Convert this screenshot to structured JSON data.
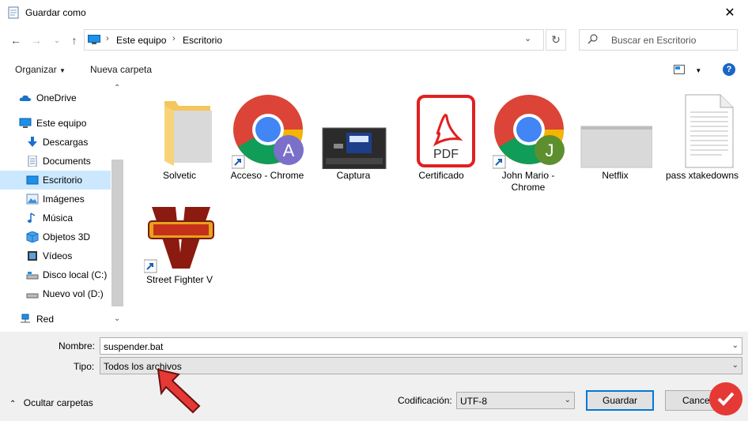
{
  "window": {
    "title": "Guardar como"
  },
  "address": {
    "crumbs": [
      "Este equipo",
      "Escritorio"
    ]
  },
  "search": {
    "placeholder": "Buscar en Escritorio"
  },
  "toolbar": {
    "organize": "Organizar",
    "new_folder": "Nueva carpeta"
  },
  "sidebar": {
    "items": [
      {
        "label": "OneDrive",
        "icon": "cloud-icon"
      },
      {
        "label": "Este equipo",
        "icon": "computer-icon"
      },
      {
        "label": "Descargas",
        "icon": "download-icon"
      },
      {
        "label": "Documents",
        "icon": "document-icon"
      },
      {
        "label": "Escritorio",
        "icon": "desktop-icon",
        "selected": true
      },
      {
        "label": "Imágenes",
        "icon": "image-icon"
      },
      {
        "label": "Música",
        "icon": "music-icon"
      },
      {
        "label": "Objetos 3D",
        "icon": "cube-icon"
      },
      {
        "label": "Vídeos",
        "icon": "video-icon"
      },
      {
        "label": "Disco local (C:)",
        "icon": "drive-icon"
      },
      {
        "label": "Nuevo vol (D:)",
        "icon": "drive-icon"
      },
      {
        "label": "Red",
        "icon": "network-icon"
      }
    ]
  },
  "files": [
    {
      "name": "Solvetic",
      "icon": "folder-icon"
    },
    {
      "name": "Acceso - Chrome",
      "icon": "chrome-icon",
      "badge": "A"
    },
    {
      "name": "Captura",
      "icon": "image-thumbnail"
    },
    {
      "name": "Certificado",
      "icon": "pdf-icon",
      "badge": "PDF"
    },
    {
      "name": "John Mario - Chrome",
      "icon": "chrome-icon",
      "badge": "J"
    },
    {
      "name": "Netflix",
      "icon": "folder-icon"
    },
    {
      "name": "pass xtakedowns",
      "icon": "text-file-icon"
    },
    {
      "name": "Street Fighter V",
      "icon": "game-icon"
    }
  ],
  "form": {
    "name_label": "Nombre:",
    "name_value": "suspender.bat",
    "type_label": "Tipo:",
    "type_value": "Todos los archivos",
    "encoding_label": "Codificación:",
    "encoding_value": "UTF-8"
  },
  "footer": {
    "hide_folders": "Ocultar carpetas",
    "save": "Guardar",
    "cancel": "Cancelar"
  },
  "colors": {
    "accent": "#0078d7",
    "selection": "#cce8ff",
    "pointer_arrow": "#e53935"
  }
}
